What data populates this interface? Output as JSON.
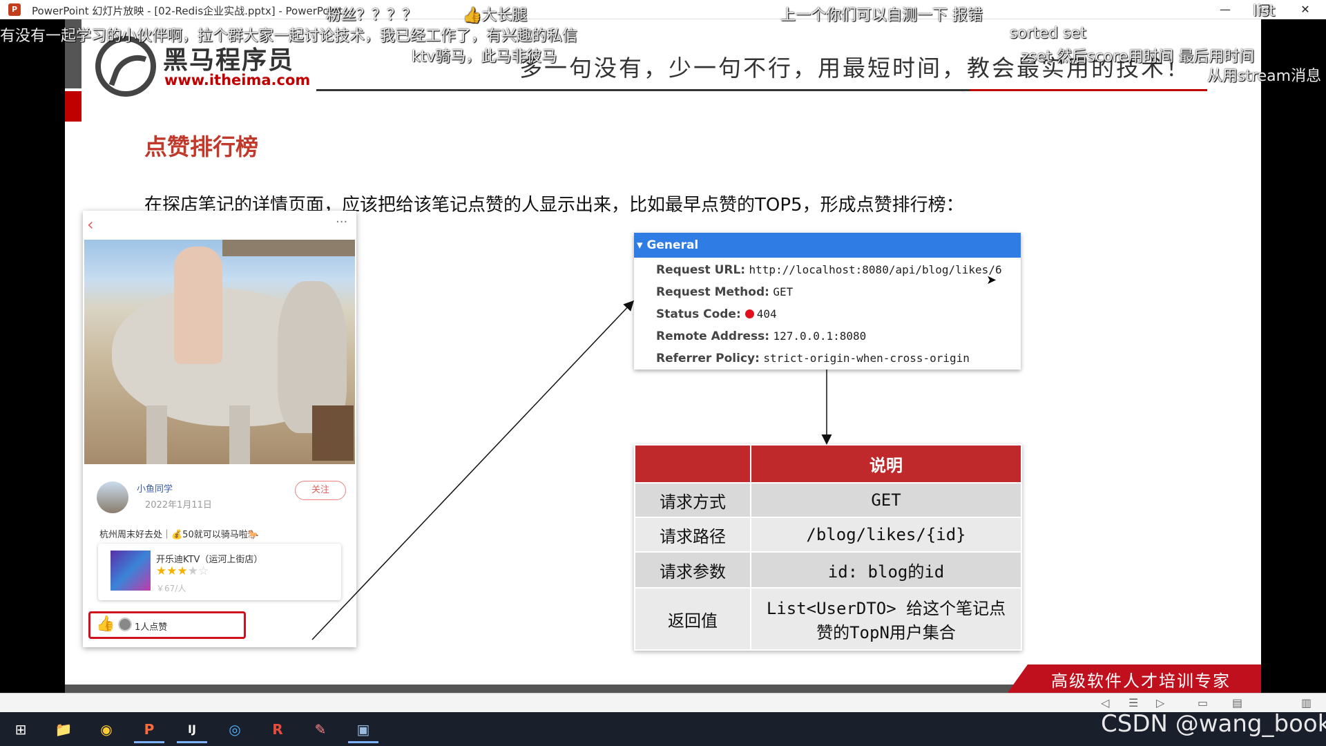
{
  "window": {
    "app_initial": "P",
    "title": "PowerPoint 幻灯片放映 - [02-Redis企业实战.pptx] - PowerPoint",
    "minimize": "—",
    "restore": "❐",
    "close": "✕"
  },
  "slide": {
    "logo_brand": "黑马程序员",
    "logo_url": "www.itheima.com",
    "slogan": "多一句没有，少一句不行，用最短时间，教会最实用的技术！",
    "title": "点赞排行榜",
    "intro": "在探店笔记的详情页面，应该把给该笔记点赞的人显示出来，比如最早点赞的TOP5，形成点赞排行榜：",
    "footer": "高级软件人才培训专家"
  },
  "phone": {
    "back_icon": "‹",
    "more_icon": "···",
    "author": "小鱼同学",
    "date": "2022年1月11日",
    "follow_label": "关注",
    "blog_title": "杭州周末好去处｜💰50就可以骑马啦🐎",
    "shop_name": "开乐迪KTV（运河上街店）",
    "stars_on": "★★★",
    "stars_off": "★☆",
    "price": "￥67/人",
    "thumb_icon": "👍",
    "like_count": "1人点赞"
  },
  "general": {
    "header": "▾ General",
    "request_url_label": "Request URL:",
    "request_url": "http://localhost:8080/api/blog/likes/6",
    "request_method_label": "Request Method:",
    "request_method": "GET",
    "status_code_label": "Status Code:",
    "status_code": "404",
    "remote_address_label": "Remote Address:",
    "remote_address": "127.0.0.1:8080",
    "referrer_policy_label": "Referrer Policy:",
    "referrer_policy": "strict-origin-when-cross-origin"
  },
  "table": {
    "header_empty": "",
    "header": "说明",
    "rows": [
      {
        "k": "请求方式",
        "v": "GET"
      },
      {
        "k": "请求路径",
        "v": "/blog/likes/{id}"
      },
      {
        "k": "请求参数",
        "v": "id: blog的id"
      },
      {
        "k": "返回值",
        "v": "List<UserDTO> 给这个笔记点赞的TopN用户集合"
      }
    ]
  },
  "danmaku": [
    {
      "text": "有没有一起学习的小伙伴啊，拉个群大家一起讨论技术，我已经工作了，有兴趣的私信"
    },
    {
      "text": "粉丝？？？？"
    },
    {
      "text": "👍大长腿"
    },
    {
      "text": "上一个你们可以自测一下 报错"
    },
    {
      "text": "list"
    },
    {
      "text": "sorted set"
    },
    {
      "text": "ktv骑马，此马非彼马"
    },
    {
      "text": "zset 然后score用时间 最后用时间"
    },
    {
      "text": "从用stream消息"
    }
  ],
  "taskbar": {
    "start_icon": "⊞",
    "explorer_icon": "📁",
    "chrome_icon": "◉",
    "ppt_icon": "P",
    "idea_icon": "IJ",
    "edge_icon": "◎",
    "redis_icon": "R",
    "paint_icon": "✎",
    "terminal_icon": "▣"
  },
  "watermark": "CSDN @wang_book"
}
